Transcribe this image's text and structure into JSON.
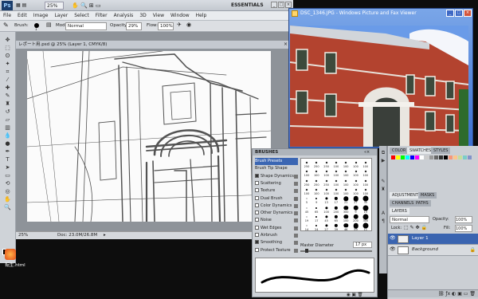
{
  "photoshop": {
    "logo": "Ps",
    "zoom": "25%",
    "workspace": "ESSENTIALS",
    "window_buttons": [
      "_",
      "□",
      "×"
    ],
    "menu": [
      "File",
      "Edit",
      "Image",
      "Layer",
      "Select",
      "Filter",
      "Analysis",
      "3D",
      "View",
      "Window",
      "Help"
    ],
    "options": {
      "brush_label": "Brush:",
      "brush_size": "1",
      "mode_label": "Mode:",
      "mode_value": "Normal",
      "opacity_label": "Opacity:",
      "opacity_value": "29%",
      "flow_label": "Flow:",
      "flow_value": "100%"
    },
    "document_tab": "レポート用.psd @ 25% (Layer 1, CMYK/8)",
    "status": {
      "zoom": "25%",
      "doc": "Doc: 23.0M/26.8M"
    }
  },
  "viewer": {
    "title": "DSC_1346.JPG - Windows Picture and Fax Viewer",
    "buttons": [
      "_",
      "□",
      "×"
    ]
  },
  "panels": {
    "top_tabs": [
      "COLOR",
      "SWATCHES",
      "STYLES"
    ],
    "mid_tabs": [
      "ADJUSTMENTS",
      "MASKS"
    ],
    "tabs2": [
      "CHANNELS",
      "PATHS"
    ],
    "layers_tab": "LAYERS",
    "blend_mode": "Normal",
    "opacity_label": "Opacity:",
    "opacity_value": "100%",
    "lock_label": "Lock:",
    "fill_label": "Fill:",
    "fill_value": "100%",
    "layers": [
      {
        "name": "Layer 1",
        "selected": true
      },
      {
        "name": "Background",
        "selected": false
      }
    ]
  },
  "brushes": {
    "title": "BRUSHES",
    "options": [
      {
        "label": "Brush Presets",
        "checked": null,
        "selected": true
      },
      {
        "label": "Brush Tip Shape",
        "checked": null,
        "selected": false
      },
      {
        "label": "Shape Dynamics",
        "checked": true,
        "selected": false
      },
      {
        "label": "Scattering",
        "checked": false,
        "selected": false
      },
      {
        "label": "Texture",
        "checked": false,
        "selected": false
      },
      {
        "label": "Dual Brush",
        "checked": false,
        "selected": false
      },
      {
        "label": "Color Dynamics",
        "checked": false,
        "selected": false
      },
      {
        "label": "Other Dynamics",
        "checked": false,
        "selected": false
      },
      {
        "label": "Noise",
        "checked": false,
        "selected": false
      },
      {
        "label": "Wet Edges",
        "checked": false,
        "selected": false
      },
      {
        "label": "Airbrush",
        "checked": false,
        "selected": false
      },
      {
        "label": "Smoothing",
        "checked": true,
        "selected": false
      },
      {
        "label": "Protect Texture",
        "checked": false,
        "selected": false
      }
    ],
    "master_diameter_label": "Master Diameter",
    "master_diameter_value": "17 px",
    "grid": [
      [
        "250",
        "250",
        "250",
        "100",
        "100",
        "100",
        "100"
      ],
      [
        "100",
        "100",
        "100",
        "100",
        "100",
        "100",
        "100"
      ],
      [
        "250",
        "250",
        "250",
        "100",
        "100",
        "100",
        "100"
      ],
      [
        "100",
        "100",
        "100",
        "100",
        "100",
        "100",
        "100"
      ],
      [
        "5",
        "9",
        "13",
        "17",
        "21",
        "27",
        "35"
      ],
      [
        "45",
        "65",
        "100",
        "200",
        "300",
        "9",
        "13"
      ],
      [
        "19",
        "17",
        "45",
        "65",
        "100",
        "200",
        "300"
      ],
      [
        "14",
        "24",
        "27",
        "39",
        "46",
        "59",
        "11"
      ]
    ]
  },
  "desktop": {
    "icon_label": "転生.html"
  }
}
